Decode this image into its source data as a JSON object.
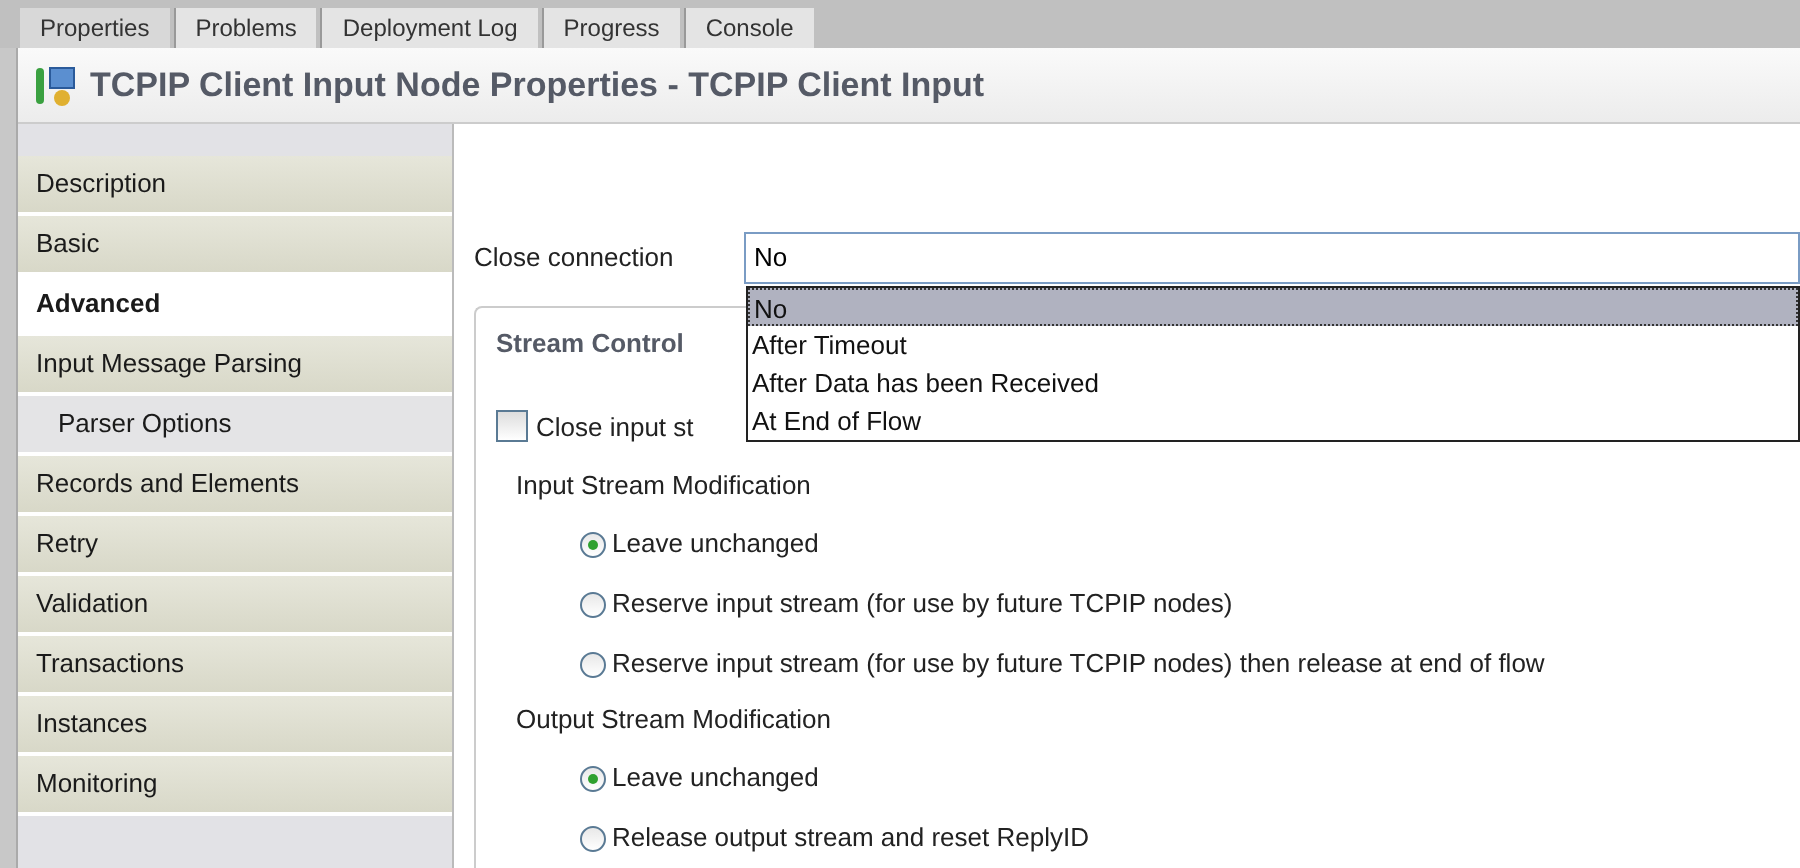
{
  "view_tabs": [
    {
      "label": "Properties",
      "selected": true
    },
    {
      "label": "Problems",
      "selected": false
    },
    {
      "label": "Deployment Log",
      "selected": false
    },
    {
      "label": "Progress",
      "selected": false
    },
    {
      "label": "Console",
      "selected": false
    }
  ],
  "header": {
    "title": "TCPIP Client Input Node Properties - TCPIP Client Input"
  },
  "sidebar": {
    "items": [
      {
        "label": "Description",
        "selected": false
      },
      {
        "label": "Basic",
        "selected": false
      },
      {
        "label": "Advanced",
        "selected": true
      },
      {
        "label": "Input Message Parsing",
        "selected": false,
        "children": [
          {
            "label": "Parser Options",
            "selected": false
          }
        ]
      },
      {
        "label": "Records and Elements",
        "selected": false
      },
      {
        "label": "Retry",
        "selected": false
      },
      {
        "label": "Validation",
        "selected": false
      },
      {
        "label": "Transactions",
        "selected": false
      },
      {
        "label": "Instances",
        "selected": false
      },
      {
        "label": "Monitoring",
        "selected": false
      }
    ]
  },
  "close_connection": {
    "label": "Close connection",
    "value": "No",
    "expanded": true,
    "options": [
      {
        "label": "No",
        "selected": true
      },
      {
        "label": "After Timeout",
        "selected": false
      },
      {
        "label": "After Data has been Received",
        "selected": false
      },
      {
        "label": "At End of Flow",
        "selected": false
      }
    ]
  },
  "stream_control": {
    "title": "Stream Control",
    "close_input_stream": {
      "label": "Close input st",
      "checked": false
    },
    "groups": [
      {
        "title": "Input Stream Modification",
        "options": [
          {
            "label": "Leave unchanged",
            "selected": true
          },
          {
            "label": "Reserve input stream (for use by future TCPIP nodes)",
            "selected": false
          },
          {
            "label": "Reserve input stream (for use by future TCPIP nodes) then release at end of flow",
            "selected": false
          }
        ]
      },
      {
        "title": "Output Stream Modification",
        "options": [
          {
            "label": "Leave unchanged",
            "selected": true
          },
          {
            "label": "Release output stream and reset ReplyID",
            "selected": false
          }
        ]
      }
    ]
  }
}
